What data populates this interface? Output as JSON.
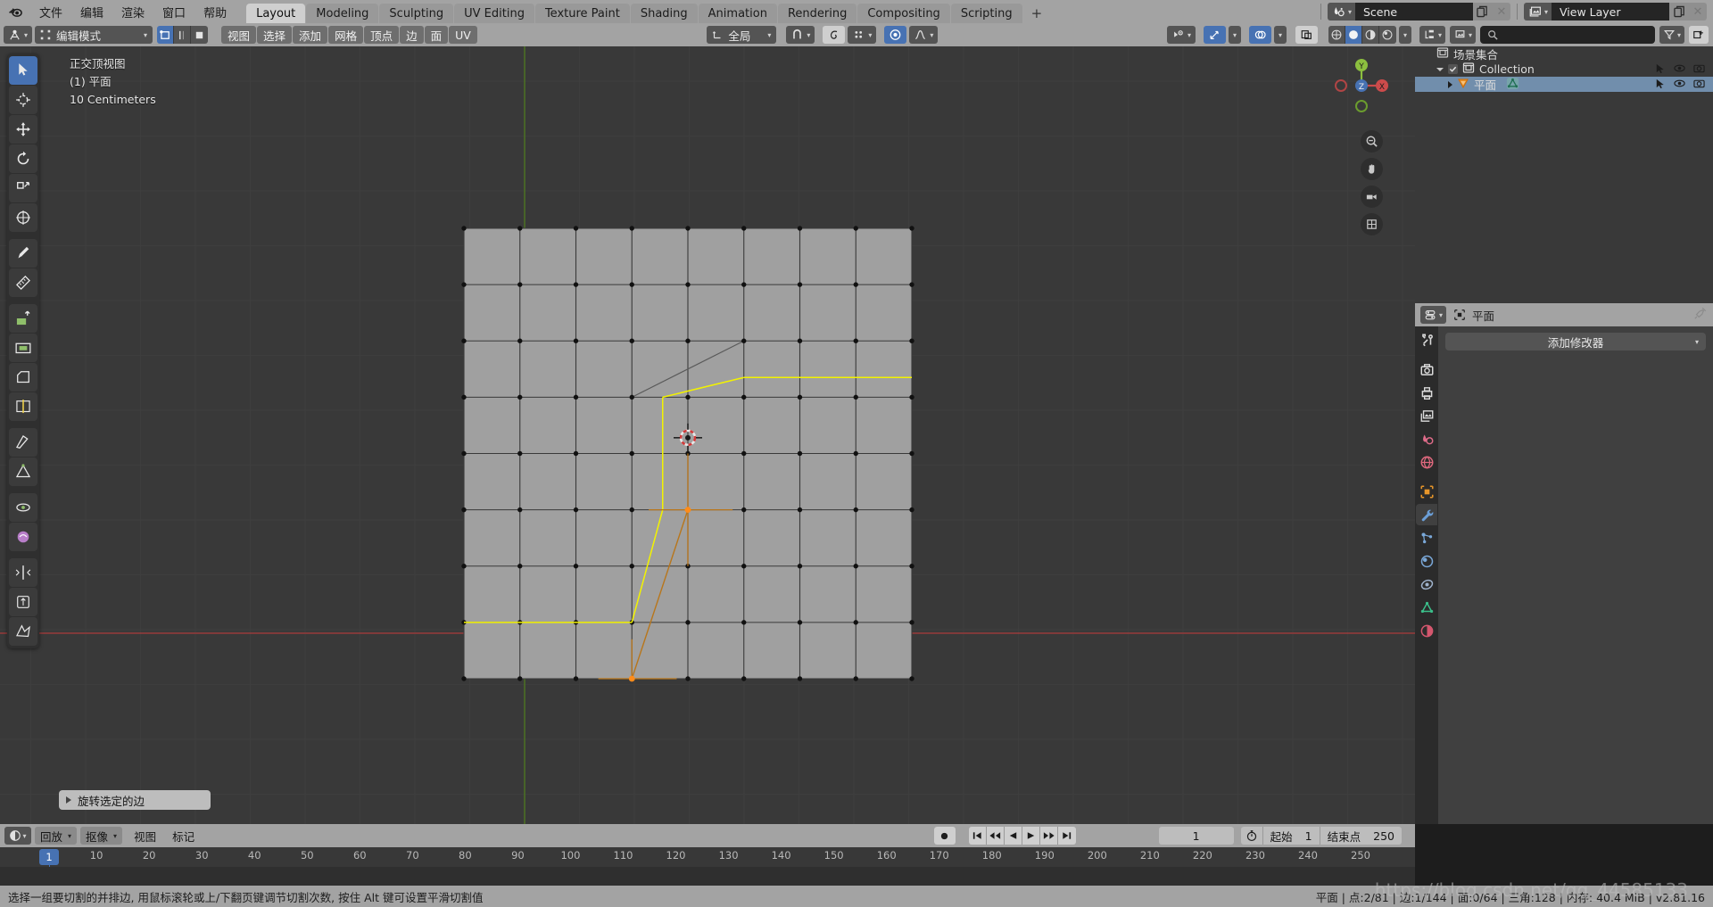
{
  "app": {
    "title": "Blender",
    "version": "v2.81.16"
  },
  "topbar": {
    "logo_icon": "blender-logo-icon",
    "menus": [
      "文件",
      "编辑",
      "渲染",
      "窗口",
      "帮助"
    ],
    "workspace_tabs": [
      {
        "label": "Layout",
        "active": true
      },
      {
        "label": "Modeling",
        "active": false
      },
      {
        "label": "Sculpting",
        "active": false
      },
      {
        "label": "UV Editing",
        "active": false
      },
      {
        "label": "Texture Paint",
        "active": false
      },
      {
        "label": "Shading",
        "active": false
      },
      {
        "label": "Animation",
        "active": false
      },
      {
        "label": "Rendering",
        "active": false
      },
      {
        "label": "Compositing",
        "active": false
      },
      {
        "label": "Scripting",
        "active": false
      }
    ],
    "add_workspace_label": "+",
    "scene": {
      "icon": "scene-icon",
      "value": "Scene",
      "new_icon": "copy-icon",
      "unlink_icon": "x-icon"
    },
    "view_layer": {
      "icon": "view-layer-icon",
      "value": "View Layer",
      "new_icon": "copy-icon",
      "unlink_icon": "x-icon"
    }
  },
  "viewport": {
    "header": {
      "editor_icon": "editor-type-3dview-icon",
      "mode": "编辑模式",
      "select_modes": [
        {
          "name": "vertex-select-icon",
          "active": true
        },
        {
          "name": "edge-select-icon",
          "active": false
        },
        {
          "name": "face-select-icon",
          "active": false
        }
      ],
      "menus": [
        "视图",
        "选择",
        "添加",
        "网格",
        "顶点",
        "边",
        "面",
        "UV"
      ],
      "transform_orientation": {
        "icon": "orientation-icon",
        "value": "全局"
      },
      "snap": {
        "icon": "magnet-icon",
        "active": false
      },
      "proportional": {
        "icon": "proportional-edit-icon",
        "active": false
      },
      "proportional_falloff": {
        "icon": "falloff-smooth-icon"
      },
      "mesh_edit_mode_toggle": {
        "icon": "mesh-options-icon",
        "active": true
      },
      "visibility_icon": "show-overlays-icon",
      "gizmo_icon": "gizmo-icon",
      "overlays_icon": "overlays-icon",
      "xray_icon": "xray-toggle-icon",
      "shading_modes": [
        {
          "name": "shading-wireframe-icon",
          "active": false
        },
        {
          "name": "shading-solid-icon",
          "active": true
        },
        {
          "name": "shading-material-icon",
          "active": false
        },
        {
          "name": "shading-rendered-icon",
          "active": false
        }
      ]
    },
    "overlay_text": {
      "view_name": "正交顶视图",
      "collection_object": "(1) 平面",
      "grid_scale": "10 Centimeters"
    },
    "toolbar_tools": [
      {
        "name": "tool-tweak-icon",
        "active": true
      },
      {
        "name": "tool-cursor-icon",
        "active": false
      },
      {
        "name": "tool-move-icon",
        "active": false
      },
      {
        "name": "tool-rotate-icon",
        "active": false
      },
      {
        "name": "tool-scale-icon",
        "active": false
      },
      {
        "name": "tool-transform-icon",
        "active": false
      },
      {
        "name": "tool-annotate-icon",
        "active": false
      },
      {
        "name": "tool-measure-icon",
        "active": false
      },
      {
        "name": "tool-extrude-region-icon",
        "active": false
      },
      {
        "name": "tool-inset-faces-icon",
        "active": false
      },
      {
        "name": "tool-bevel-icon",
        "active": false
      },
      {
        "name": "tool-loop-cut-icon",
        "active": false
      },
      {
        "name": "tool-knife-icon",
        "active": false
      },
      {
        "name": "tool-poly-build-icon",
        "active": false
      },
      {
        "name": "tool-spin-icon",
        "active": false
      },
      {
        "name": "tool-smooth-icon",
        "active": false
      },
      {
        "name": "tool-edge-slide-icon",
        "active": false
      },
      {
        "name": "tool-shrink-fatten-icon",
        "active": false
      },
      {
        "name": "tool-rip-region-icon",
        "active": false
      }
    ],
    "nav_gizmo": {
      "axes": [
        {
          "label": "Y",
          "color": "#8cbf3f"
        },
        {
          "label": "Z",
          "color": "#4772b3"
        },
        {
          "label": "X",
          "color": "#cc4b4b"
        }
      ]
    },
    "nav_buttons": [
      {
        "name": "zoom-icon"
      },
      {
        "name": "pan-hand-icon"
      },
      {
        "name": "camera-view-icon"
      },
      {
        "name": "toggle-ortho-icon"
      }
    ],
    "operator_panel": {
      "label": "旋转选定的边",
      "expand_icon": "triangle-right-icon"
    },
    "colors": {
      "face": "#a0a0a0",
      "wire": "#3a3a3a",
      "selected_edge": "#f2f200",
      "active_vert": "#ff8c1a",
      "grid": "#4a4a4a",
      "axis_x": "#aa3b3b",
      "axis_y": "#4f7a20",
      "background": "#393939"
    }
  },
  "outliner": {
    "header": {
      "display_mode_icon": "outliner-display-mode-icon",
      "filter_id_icon": "filter-id-icon",
      "search_icon": "search-icon",
      "search_value": "",
      "filter_icon": "funnel-icon",
      "new_collection_icon": "new-collection-icon"
    },
    "rows": [
      {
        "label": "场景集合",
        "icon": "scene-collection-icon",
        "indent": 0,
        "disclosure": "",
        "checkbox": false,
        "selected": false,
        "right_icons": []
      },
      {
        "label": "Collection",
        "icon": "collection-icon",
        "indent": 1,
        "disclosure": "down",
        "checkbox": true,
        "selected": false,
        "right_icons": [
          "cursor-select-icon",
          "eye-icon",
          "camera-icon"
        ]
      },
      {
        "label": "平面",
        "icon": "mesh-object-icon",
        "data_icon": "mesh-data-icon",
        "indent": 2,
        "disclosure": "right",
        "checkbox": false,
        "selected": true,
        "right_icons": [
          "cursor-select-icon",
          "eye-icon",
          "camera-icon"
        ]
      }
    ]
  },
  "properties": {
    "header": {
      "editor_icon": "editor-type-properties-icon",
      "breadcrumb_icon": "object-icon",
      "breadcrumb_label": "平面",
      "pin_icon": "pin-icon"
    },
    "tabs": [
      {
        "name": "tab-tool",
        "icon": "tool-icon",
        "active": false,
        "group": 0
      },
      {
        "name": "tab-render",
        "icon": "render-camera-icon",
        "active": false,
        "group": 1
      },
      {
        "name": "tab-output",
        "icon": "printer-icon",
        "active": false,
        "group": 1
      },
      {
        "name": "tab-view-layer",
        "icon": "images-icon",
        "active": false,
        "group": 1
      },
      {
        "name": "tab-scene",
        "icon": "scene-props-icon",
        "active": false,
        "group": 1
      },
      {
        "name": "tab-world",
        "icon": "world-globe-icon",
        "active": false,
        "group": 1
      },
      {
        "name": "tab-object",
        "icon": "object-square-icon",
        "active": false,
        "group": 2
      },
      {
        "name": "tab-modifiers",
        "icon": "wrench-icon",
        "active": true,
        "group": 2
      },
      {
        "name": "tab-particles",
        "icon": "particles-icon",
        "active": false,
        "group": 2
      },
      {
        "name": "tab-physics",
        "icon": "physics-orbit-icon",
        "active": false,
        "group": 2
      },
      {
        "name": "tab-constraints",
        "icon": "constraints-icon",
        "active": false,
        "group": 2
      },
      {
        "name": "tab-object-data",
        "icon": "mesh-data-triangle-icon",
        "active": false,
        "group": 2
      },
      {
        "name": "tab-material",
        "icon": "material-sphere-icon",
        "active": false,
        "group": 2
      }
    ],
    "add_modifier_label": "添加修改器",
    "add_modifier_caret": "chevron-down-icon"
  },
  "timeline": {
    "header": {
      "editor_icon": "editor-type-timeline-icon",
      "playback_label": "回放",
      "keying_label": "抠像",
      "menus": [
        "视图",
        "标记"
      ],
      "record_icon": "record-icon",
      "transport": [
        "jump-to-start-icon",
        "prev-keyframe-icon",
        "play-reverse-icon",
        "play-icon",
        "next-keyframe-icon",
        "jump-to-end-icon"
      ],
      "current_frame": "1",
      "frame_range_icon": "stopwatch-icon",
      "start_label": "起始",
      "start_value": "1",
      "end_label": "结束点",
      "end_value": "250"
    },
    "ruler_ticks": [
      10,
      20,
      30,
      40,
      50,
      60,
      70,
      80,
      90,
      100,
      110,
      120,
      130,
      140,
      150,
      160,
      170,
      180,
      190,
      200,
      210,
      220,
      230,
      240,
      250
    ],
    "playhead_frame": "1"
  },
  "statusbar": {
    "hint": "选择一组要切割的并排边, 用鼠标滚轮或上/下翻页键调节切割次数, 按住 Alt 键可设置平滑切割值",
    "stats": "平面 | 点:2/81 | 边:1/144 | 面:0/64 | 三角:128  | 内存: 40.4 MiB | v2.81.16"
  },
  "watermark": "https://blog.csdn.net/qq_44585133"
}
